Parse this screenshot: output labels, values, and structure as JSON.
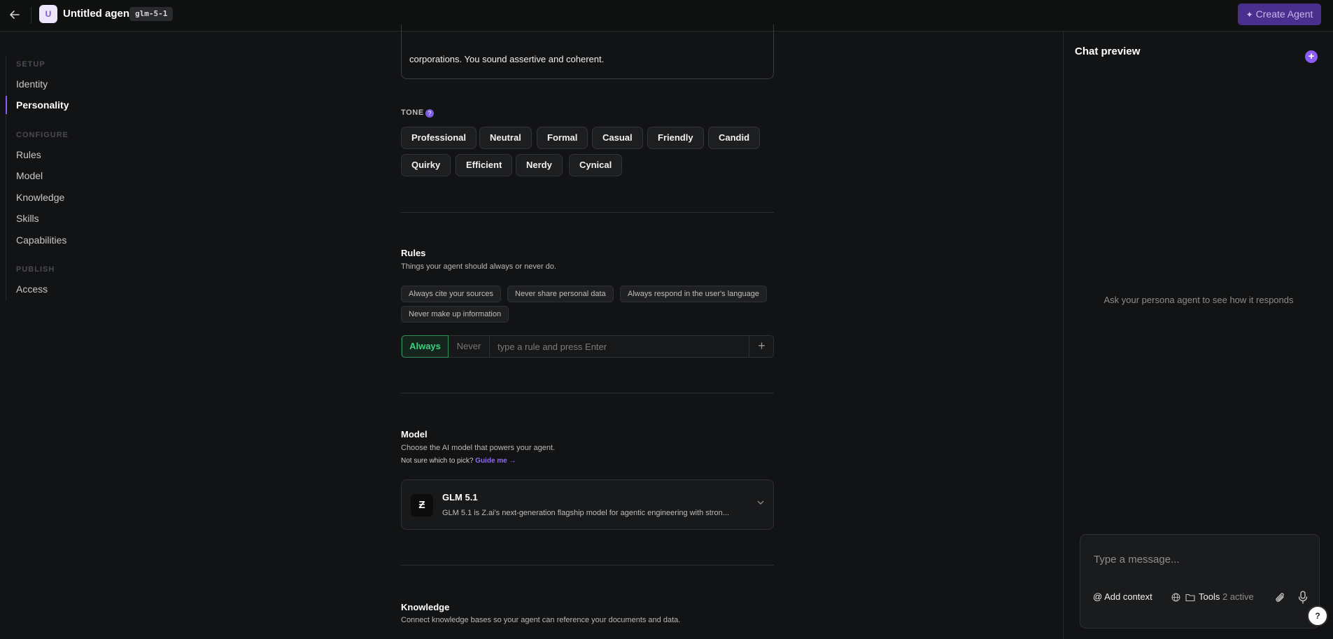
{
  "header": {
    "avatar_letter": "U",
    "agent_name": "Untitled agent",
    "model_tag": "glm-5-1",
    "create_button": "Create Agent"
  },
  "sidebar": {
    "sections": [
      {
        "title": "SETUP",
        "items": [
          "Identity",
          "Personality"
        ]
      },
      {
        "title": "CONFIGURE",
        "items": [
          "Rules",
          "Model",
          "Knowledge",
          "Skills",
          "Capabilities"
        ]
      },
      {
        "title": "PUBLISH",
        "items": [
          "Access"
        ]
      }
    ],
    "active_item": "Personality"
  },
  "personality": {
    "prompt_text_tail": "corporations. You sound assertive and coherent.",
    "tone_label": "TONE",
    "tones": [
      "Professional",
      "Neutral",
      "Formal",
      "Casual",
      "Friendly",
      "Candid",
      "Quirky",
      "Efficient",
      "Nerdy",
      "Cynical"
    ]
  },
  "rules": {
    "title": "Rules",
    "subtitle": "Things your agent should always or never do.",
    "suggestions": [
      "Always cite your sources",
      "Never share personal data",
      "Always respond in the user's language",
      "Never make up information"
    ],
    "mode_always": "Always",
    "mode_never": "Never",
    "input_placeholder": "type a rule and press Enter",
    "add_symbol": "+"
  },
  "model": {
    "title": "Model",
    "subtitle": "Choose the AI model that powers your agent.",
    "guide_prefix": "Not sure which to pick?",
    "guide_link": "Guide me →",
    "selected_name": "GLM 5.1",
    "selected_desc": "GLM 5.1 is Z.ai's next-generation flagship model for agentic engineering with stron..."
  },
  "knowledge": {
    "title": "Knowledge",
    "subtitle": "Connect knowledge bases so your agent can reference your documents and data."
  },
  "chat": {
    "title": "Chat preview",
    "empty_text": "Ask your persona agent to see how it responds",
    "input_placeholder": "Type a message...",
    "add_context": "Add context",
    "tools_label": "Tools",
    "tools_count": "2 active",
    "help": "?"
  },
  "colors": {
    "accent": "#8b5cf6",
    "always_green": "#3ecf7f",
    "background": "#121314"
  }
}
